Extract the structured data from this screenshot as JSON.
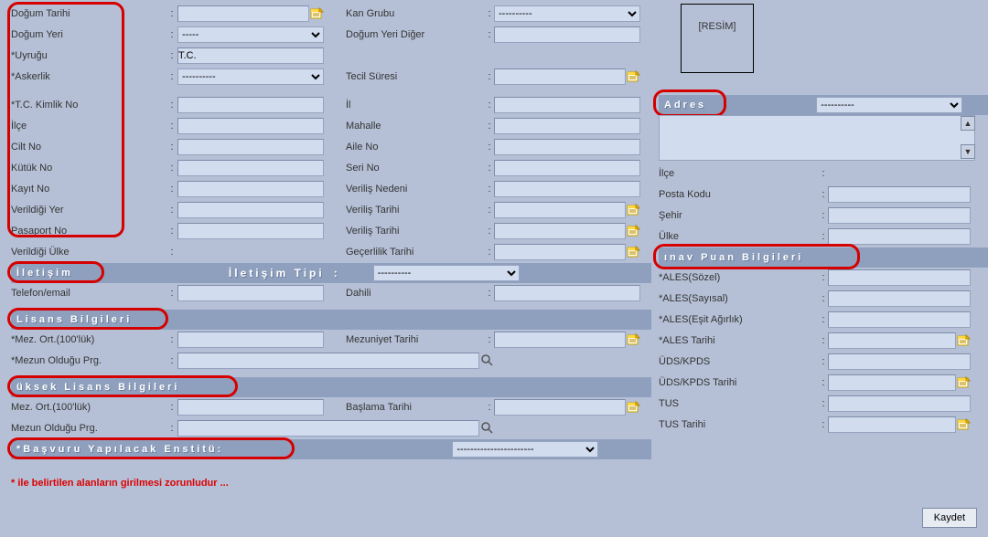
{
  "left": {
    "dogum_tarihi": "Doğum Tarihi",
    "kan_grubu": "Kan Grubu",
    "dogum_yeri": "Doğum Yeri",
    "dogum_yeri_diger": "Doğum Yeri Diğer",
    "uyrugu": "*Uyruğu",
    "uyrugu_val": "T.C.",
    "askerlik": "*Askerlik",
    "tecil": "Tecil Süresi",
    "tckn": "*T.C. Kimlik No",
    "il": "İl",
    "ilce": "İlçe",
    "mahalle": "Mahalle",
    "cilt": "Cilt No",
    "aile": "Aile No",
    "kutuk": "Kütük No",
    "seri": "Seri No",
    "kayit": "Kayıt No",
    "verilis_neden": "Veriliş Nedeni",
    "verildigi_yer": "Verildiği Yer",
    "verilis_tarihi": "Veriliş Tarihi",
    "pasaport": "Pasaport No",
    "verilis_tarihi2": "Veriliş Tarihi",
    "verildigi_ulke": "Verildiği Ülke",
    "gecerlilik": "Geçerlilik Tarihi",
    "iletisim_h": "İletişim",
    "iletisim_tipi": "İletişim Tipi",
    "telefon": "Telefon/email",
    "dahili": "Dahili",
    "lisans_h": "Lisans Bilgileri",
    "mez_ort": "*Mez. Ort.(100'lük)",
    "mezuniyet_tarihi": "Mezuniyet Tarihi",
    "mez_prg": "*Mezun Olduğu Prg.",
    "yl_h": "üksek Lisans Bilgileri",
    "yl_mez_ort": "Mez. Ort.(100'lük)",
    "yl_baslama": "Başlama Tarihi",
    "yl_mez_prg": "Mezun Olduğu Prg.",
    "basvuru_h": "*Başvuru Yapılacak Enstitü:",
    "select_dashes": "----------",
    "select5": "-----",
    "select_long": "-----------------------"
  },
  "right": {
    "resim": "[RESİM]",
    "adres_h": "Adres",
    "dash": "----------",
    "ilce": "İlçe",
    "posta": "Posta Kodu",
    "sehir": "Şehir",
    "ulke": "Ülke",
    "sinav_h": "ınav Puan Bilgileri",
    "ales_soz": "*ALES(Sözel)",
    "ales_say": "*ALES(Sayısal)",
    "ales_ea": "*ALES(Eşit Ağırlık)",
    "ales_tar": "*ALES Tarihi",
    "uds": "ÜDS/KPDS",
    "uds_tar": "ÜDS/KPDS Tarihi",
    "tus": "TUS",
    "tus_tar": "TUS Tarihi"
  },
  "footnote": "* ile belirtilen alanların girilmesi zorunludur ...",
  "save": "Kaydet",
  "colon": ":"
}
